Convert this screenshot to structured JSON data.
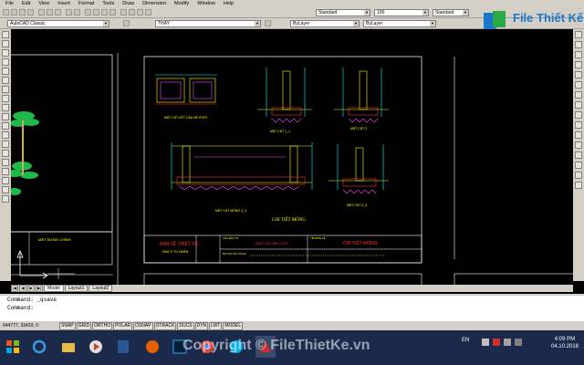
{
  "menu": [
    "File",
    "Edit",
    "View",
    "Insert",
    "Format",
    "Tools",
    "Draw",
    "Dimension",
    "Modify",
    "Window",
    "Help"
  ],
  "toolbar": {
    "text_style": "Standard",
    "dim_scale": "100",
    "table_style": "Standard"
  },
  "props": {
    "workspace": "AutoCAD Classic",
    "layer": "THAY",
    "color": "ByLayer",
    "linetype": "ByLayer"
  },
  "drawing": {
    "left_label": "MẶT ĐỨNG CHÍNH",
    "titleblock_title": "BẢN VẼ THIẾT KẾ",
    "titleblock_sub": "NHÀ Ở TƯ NHÂN",
    "owner_label": "CHỦ ĐẦU TƯ",
    "owner_name": "ÔNG CÁ VĂN LỊCH",
    "drawing_label": "TÊN BẢN VẼ",
    "drawing_name": "CHI TIẾT MÓNG",
    "address_label": "ĐỊA CHỈ XÂY DỰNG",
    "section_septic": "MẶT CẮT KẾT CẤU BỂ PHỐT",
    "section_1": "MẶT CẮT 1_1",
    "section_2": "MẶT CẮT 2",
    "section_3": "MẶT CẮT MÓNG 2_3",
    "section_4": "MẶT CẮT 3_3",
    "foundation_detail": "CHI TIẾT MÓNG"
  },
  "tabs": [
    "Model",
    "Layout1",
    "Layout2"
  ],
  "command": {
    "line1": "Command: _qsave",
    "line2": "Command:"
  },
  "status": {
    "coords": "644777, 33433, 0",
    "buttons": [
      "SNAP",
      "GRID",
      "ORTHO",
      "POLAR",
      "OSNAP",
      "OTRACK",
      "DUCS",
      "DYN",
      "LWT",
      "MODEL"
    ]
  },
  "taskbar": {
    "lang": "EN",
    "time": "4:09 PM",
    "date": "04.10.2018"
  },
  "watermark": "Copyright © FileThietKe.vn",
  "logo_text": "File Thiết Kế.vn",
  "colors": {
    "canvas_bg": "#000000",
    "cad_yellow": "#ffff00",
    "cad_red": "#ff3333",
    "cad_magenta": "#ff44ff",
    "cad_cyan": "#00ffff",
    "chrome": "#d4d0c8",
    "taskbar": "#1b2a4a"
  }
}
